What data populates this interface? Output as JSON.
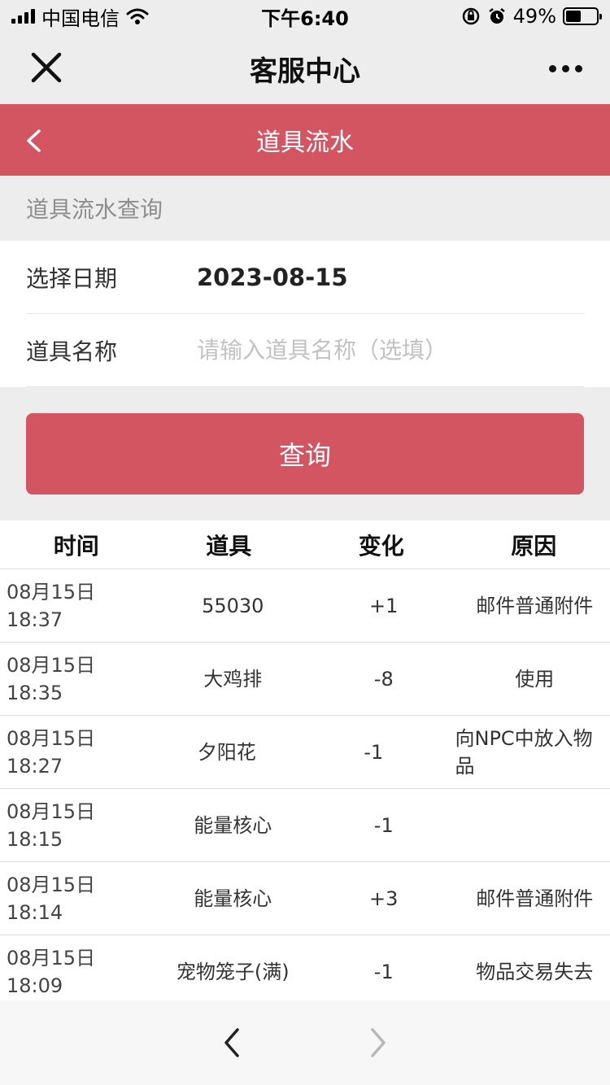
{
  "status": {
    "carrier": "中国电信",
    "time": "下午6:40",
    "battery": "49%",
    "battery_level": 0.49
  },
  "nav": {
    "title": "客服中心"
  },
  "header": {
    "title": "道具流水"
  },
  "section": {
    "title": "道具流水查询"
  },
  "form": {
    "date_label": "选择日期",
    "date_value": "2023-08-15",
    "name_label": "道具名称",
    "name_placeholder": "请输入道具名称（选填）",
    "name_value": ""
  },
  "query_button": "查询",
  "table": {
    "headers": [
      "时间",
      "道具",
      "变化",
      "原因"
    ],
    "rows": [
      {
        "date": "08月15日",
        "time": "18:37",
        "item": "55030",
        "change": "+1",
        "reason": "邮件普通附件"
      },
      {
        "date": "08月15日",
        "time": "18:35",
        "item": "大鸡排",
        "change": "-8",
        "reason": "使用"
      },
      {
        "date": "08月15日",
        "time": "18:27",
        "item": "夕阳花",
        "change": "-1",
        "reason": "向NPC中放入物品"
      },
      {
        "date": "08月15日",
        "time": "18:15",
        "item": "能量核心",
        "change": "-1",
        "reason": ""
      },
      {
        "date": "08月15日",
        "time": "18:14",
        "item": "能量核心",
        "change": "+3",
        "reason": "邮件普通附件"
      },
      {
        "date": "08月15日",
        "time": "18:09",
        "item": "宠物笼子(满)",
        "change": "-1",
        "reason": "物品交易失去"
      }
    ]
  },
  "colors": {
    "accent": "#d45562",
    "background": "#ededed"
  }
}
